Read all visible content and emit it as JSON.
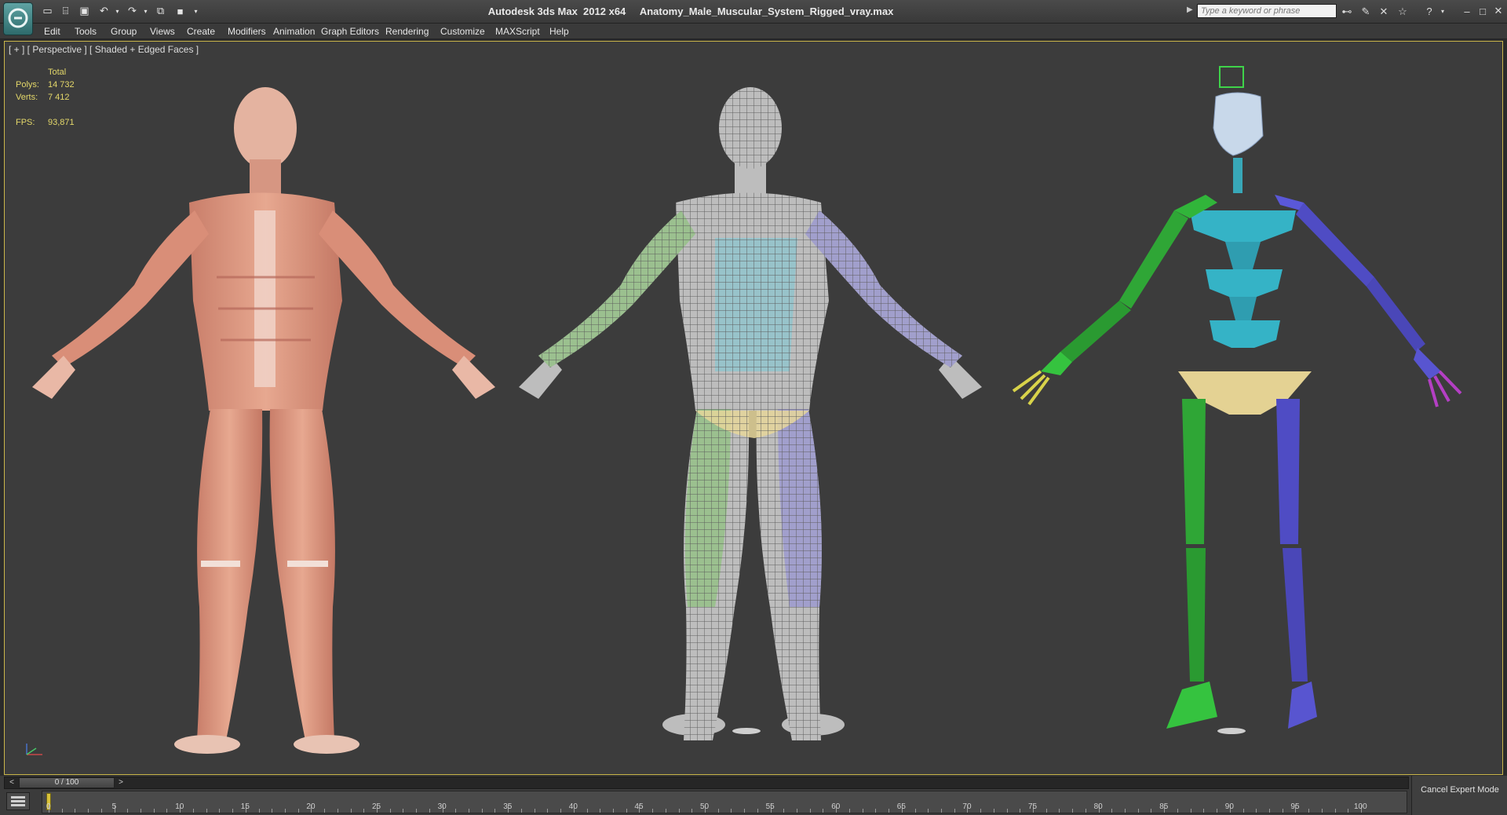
{
  "window": {
    "title": "Autodesk 3ds Max  2012 x64     Anatomy_Male_Muscular_System_Rigged_vray.max",
    "search_placeholder": "Type a keyword or phrase"
  },
  "toolbar_icons": [
    "new-file-icon",
    "open-file-icon",
    "save-icon",
    "undo-icon",
    "redo-icon",
    "hold-icon",
    "project-folder-icon"
  ],
  "help_icons": [
    "binoculars-icon",
    "communication-icon",
    "tools-icon",
    "favorites-star-icon",
    "help-icon"
  ],
  "menu": [
    "Edit",
    "Tools",
    "Group",
    "Views",
    "Create",
    "Modifiers",
    "Animation",
    "Graph Editors",
    "Rendering",
    "Customize",
    "MAXScript",
    "Help"
  ],
  "viewport": {
    "label": "[ + ] [ Perspective ] [ Shaded + Edged Faces ]",
    "stats": {
      "header": "Total",
      "polys_label": "Polys:",
      "polys_value": "14 732",
      "verts_label": "Verts:",
      "verts_value": "7 412",
      "fps_label": "FPS:",
      "fps_value": "93,871"
    }
  },
  "time_slider": {
    "label": "0 / 100",
    "prev": "<",
    "next": ">"
  },
  "timeline": {
    "start": 0,
    "end": 100,
    "major_every": 5,
    "labels": [
      "0",
      "5",
      "10",
      "15",
      "20",
      "25",
      "30",
      "35",
      "40",
      "45",
      "50",
      "55",
      "60",
      "65",
      "70",
      "75",
      "80",
      "85",
      "90",
      "95",
      "100"
    ]
  },
  "cancel_expert": "Cancel Expert Mode",
  "colors": {
    "viewport_bg": "#3c3c3c",
    "active_border": "#c9b54a",
    "stats_text": "#e4d86a"
  }
}
